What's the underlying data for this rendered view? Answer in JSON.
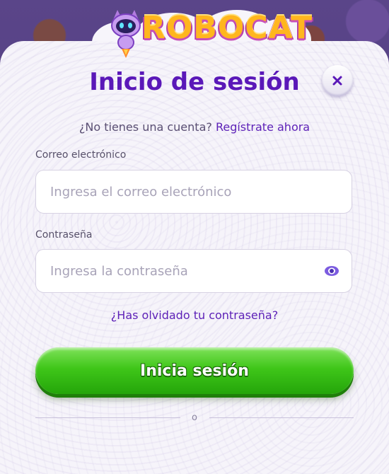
{
  "brand": {
    "logo_text": "ROBOCAT"
  },
  "modal": {
    "title": "Inicio de sesión",
    "close_icon": "close-icon",
    "signup_prompt": "¿No tienes una cuenta?",
    "signup_link": "Regístrate ahora"
  },
  "form": {
    "email_label": "Correo electrónico",
    "email_placeholder": "Ingresa el correo electrónico",
    "email_value": "",
    "password_label": "Contraseña",
    "password_placeholder": "Ingresa la contraseña",
    "password_value": "",
    "toggle_icon": "eye-icon",
    "forgot_link": "¿Has olvidado tu contraseña?",
    "submit_label": "Inicia sesión",
    "separator": "o"
  },
  "colors": {
    "title": "#5a18b8",
    "link": "#5e22b8",
    "primary_button": "#3fc619",
    "background": "#4e3a7c"
  }
}
